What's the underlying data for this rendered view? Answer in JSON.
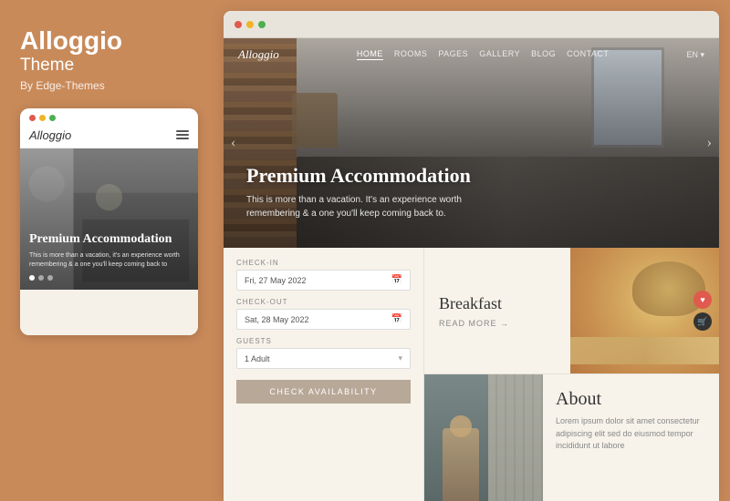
{
  "left": {
    "title": "Alloggio",
    "subtitle": "Theme",
    "author": "By Edge-Themes",
    "mobile": {
      "logo": "Alloggio",
      "hero_title": "Premium\nAccommodation",
      "hero_text": "This is more than a vacation, it's an experience worth remembering & a one you'll keep coming back to",
      "dots": [
        "active",
        "inactive",
        "inactive"
      ]
    }
  },
  "browser": {
    "hero": {
      "logo": "Alloggio",
      "nav_links": [
        {
          "label": "HOME",
          "active": true
        },
        {
          "label": "ROOMS",
          "active": false
        },
        {
          "label": "PAGES",
          "active": false
        },
        {
          "label": "GALLERY",
          "active": false
        },
        {
          "label": "BLOG",
          "active": false
        },
        {
          "label": "CONTACT",
          "active": false
        }
      ],
      "lang": "EN ▾",
      "title": "Premium Accommodation",
      "description": "This is more than a vacation. It's an experience worth remembering & a one you'll keep coming back to.",
      "arrow_left": "‹",
      "arrow_right": "›"
    },
    "booking": {
      "checkin_label": "CHECK-IN",
      "checkin_value": "Fri, 27 May 2022",
      "checkout_label": "CHECK-OUT",
      "checkout_value": "Sat, 28 May 2022",
      "guests_label": "GUESTS",
      "guests_value": "1 Adult",
      "button_label": "CHECK AVAILABILITY"
    },
    "breakfast": {
      "title": "Breakfast",
      "read_more": "READ MORE"
    },
    "about": {
      "title": "About",
      "text": "Lorem ipsum dolor sit amet consectetur adipiscing elit sed do eiusmod tempor incididunt ut labore"
    }
  },
  "colors": {
    "bg_left": "#c98a5a",
    "accent": "#b8a898",
    "text_dark": "#333333",
    "text_light": "#888888"
  }
}
